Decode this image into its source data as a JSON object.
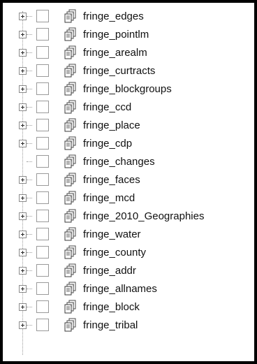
{
  "tree": {
    "items": [
      {
        "label": "fringe_edges",
        "expandable": true
      },
      {
        "label": "fringe_pointlm",
        "expandable": true
      },
      {
        "label": "fringe_arealm",
        "expandable": true
      },
      {
        "label": "fringe_curtracts",
        "expandable": true
      },
      {
        "label": "fringe_blockgroups",
        "expandable": true
      },
      {
        "label": "fringe_ccd",
        "expandable": true
      },
      {
        "label": "fringe_place",
        "expandable": true
      },
      {
        "label": "fringe_cdp",
        "expandable": true
      },
      {
        "label": "fringe_changes",
        "expandable": false
      },
      {
        "label": "fringe_faces",
        "expandable": true
      },
      {
        "label": "fringe_mcd",
        "expandable": true
      },
      {
        "label": "fringe_2010_Geographies",
        "expandable": true
      },
      {
        "label": "fringe_water",
        "expandable": true
      },
      {
        "label": "fringe_county",
        "expandable": true
      },
      {
        "label": "fringe_addr",
        "expandable": true
      },
      {
        "label": "fringe_allnames",
        "expandable": true
      },
      {
        "label": "fringe_block",
        "expandable": true
      },
      {
        "label": "fringe_tribal",
        "expandable": true
      }
    ]
  },
  "icon": "layer-group-icon",
  "colors": {
    "border": "#000000",
    "tree_line": "#9a9a9a",
    "checkbox_border": "#9a9a9a",
    "text": "#111111"
  }
}
